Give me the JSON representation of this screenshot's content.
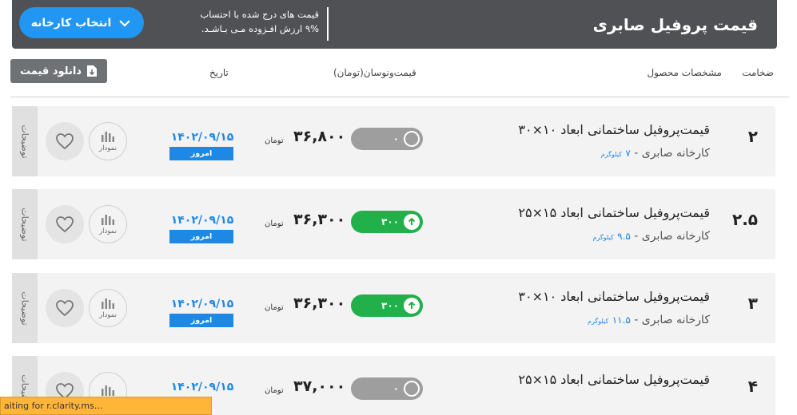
{
  "header": {
    "title": "قیمت پروفیل صابری",
    "note_line1": "قیمت های درج شده با احتساب",
    "note_line2": "۹% ارزش افـزوده مـی بـاشـد.",
    "factory_button": "انتخاب کارخانه"
  },
  "toolbar": {
    "download_label": "دانلود قیمت"
  },
  "columns": {
    "thickness": "ضخامت",
    "specs": "مشخصات محصول",
    "price_change": "قیمت‌ونوسان(تومان)",
    "date": "تاریخ"
  },
  "rows": [
    {
      "thickness": "۲",
      "title": "قیمت‌پروفیل ساختمانی ابعاد ۱۰×۳۰",
      "factory": "کارخانه صابری - ",
      "weight": "۷",
      "weight_unit": "کیلوگرم",
      "change": "۰",
      "change_state": "gray",
      "price": "۳۶,۸۰۰",
      "unit": "تومان",
      "date": "۱۴۰۲/۰۹/۱۵",
      "today": "امروز",
      "chart_label": "نمودار",
      "desc_label": "توضیحات"
    },
    {
      "thickness": "۲.۵",
      "title": "قیمت‌پروفیل ساختمانی ابعاد ۱۵×۲۵",
      "factory": "کارخانه صابری - ",
      "weight": "۹.۵",
      "weight_unit": "کیلوگرم",
      "change": "۳۰۰",
      "change_state": "green",
      "price": "۳۶,۳۰۰",
      "unit": "تومان",
      "date": "۱۴۰۲/۰۹/۱۵",
      "today": "امروز",
      "chart_label": "نمودار",
      "desc_label": "توضیحات"
    },
    {
      "thickness": "۳",
      "title": "قیمت‌پروفیل ساختمانی ابعاد ۱۰×۳۰",
      "factory": "کارخانه صابری - ",
      "weight": "۱۱.۵",
      "weight_unit": "کیلوگرم",
      "change": "۳۰۰",
      "change_state": "green",
      "price": "۳۶,۳۰۰",
      "unit": "تومان",
      "date": "۱۴۰۲/۰۹/۱۵",
      "today": "امروز",
      "chart_label": "نمودار",
      "desc_label": "توضیحات"
    },
    {
      "thickness": "۴",
      "title": "قیمت‌پروفیل ساختمانی ابعاد ۱۵×۲۵",
      "factory": "",
      "weight": "",
      "weight_unit": "",
      "change": "۰",
      "change_state": "gray",
      "price": "۳۷,۰۰۰",
      "unit": "تومان",
      "date": "۱۴۰۲/۰۹/۱۵",
      "today": "",
      "chart_label": "",
      "desc_label": "توضیحات"
    }
  ],
  "status": {
    "text": "aiting for r.clarity.ms..."
  },
  "colors": {
    "header_bg": "#4f5154",
    "accent_blue": "#2196f3",
    "up_green": "#22b04b",
    "neutral_gray": "#9e9e9e",
    "status_bar": "#ffb638"
  }
}
